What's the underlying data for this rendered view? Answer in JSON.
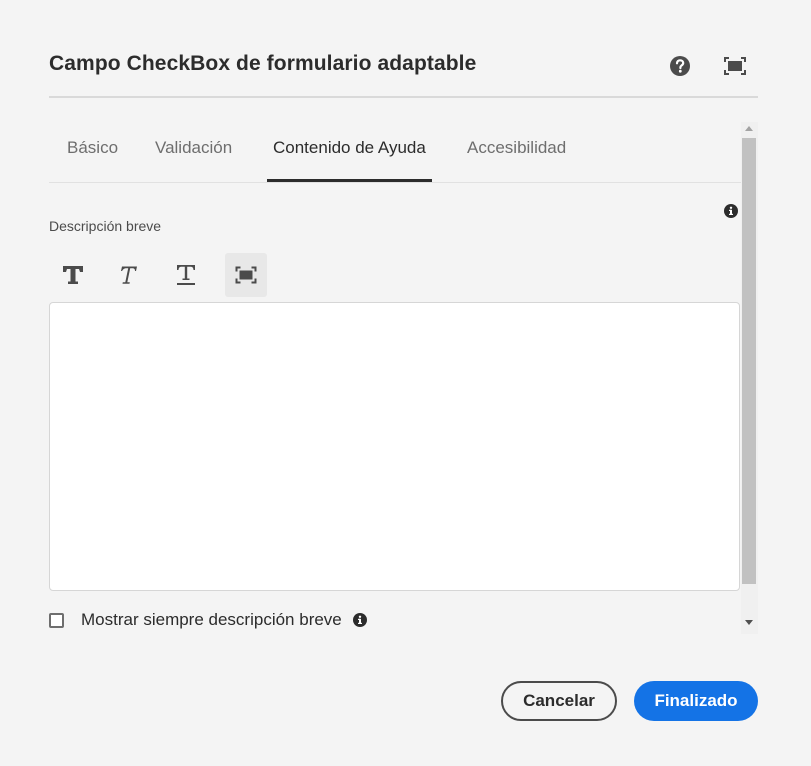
{
  "dialog": {
    "title": "Campo CheckBox de formulario adaptable",
    "help_icon": "help-circle-icon",
    "fullscreen_icon": "fullscreen-icon"
  },
  "tabs": [
    {
      "label": "Básico",
      "selected": false
    },
    {
      "label": "Validación",
      "selected": false
    },
    {
      "label": "Contenido de Ayuda",
      "selected": true
    },
    {
      "label": "Accesibilidad",
      "selected": false
    }
  ],
  "help_content": {
    "field_label": "Descripción breve",
    "info_icon": "info-circle-icon",
    "toolbar": {
      "bold_icon": "bold-icon",
      "italic_icon": "italic-icon",
      "underline_icon": "underline-icon",
      "fullscreen_icon": "fullscreen-icon"
    },
    "editor_value": "",
    "checkbox": {
      "label": "Mostrar siempre descripción breve",
      "checked": false
    }
  },
  "footer": {
    "cancel_label": "Cancelar",
    "done_label": "Finalizado"
  },
  "colors": {
    "background": "#f4f4f4",
    "primary": "#1473e6",
    "text": "#2c2c2c"
  }
}
